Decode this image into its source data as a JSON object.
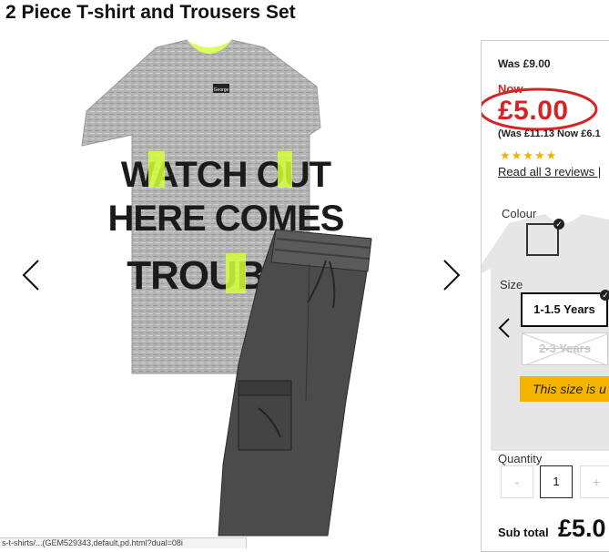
{
  "product": {
    "title": "2 Piece T-shirt and Trousers Set"
  },
  "gallery": {
    "tshirt_text_line1": "WATCH OUT",
    "tshirt_text_line2": "HERE COMES",
    "tshirt_text_line3": "TROUB",
    "tag_text": "George",
    "prev_icon": "chevron-left-icon",
    "next_icon": "chevron-right-icon"
  },
  "pricing": {
    "was": "Was £9.00",
    "now_label": "Now",
    "price": "£5.00",
    "was_now_secondary": "(Was £11.13 Now £6.1",
    "rating_stars": "★★★★★",
    "rating_value": 4.5,
    "reviews_link": "Read all 3 reviews |",
    "price_color": "#d32525"
  },
  "colour": {
    "label": "Colour",
    "selected_swatch": "#e6e6e6"
  },
  "size": {
    "label": "Size",
    "options": [
      {
        "label": "1-1.5 Years",
        "selected": true,
        "available": true
      },
      {
        "label": "2-3 Years",
        "selected": false,
        "available": false
      }
    ],
    "notice": "This size is u"
  },
  "quantity": {
    "label": "Quantity",
    "minus": "-",
    "value": "1",
    "plus": "+"
  },
  "subtotal": {
    "label": "Sub total",
    "value": "£5.0"
  },
  "statusbar": {
    "url": "s-t-shirts/...(GEM529343,default,pd.html?dual=08i"
  },
  "colors": {
    "accent_red": "#d32525",
    "notice_yellow": "#f5b400",
    "text_dark": "#111111"
  }
}
